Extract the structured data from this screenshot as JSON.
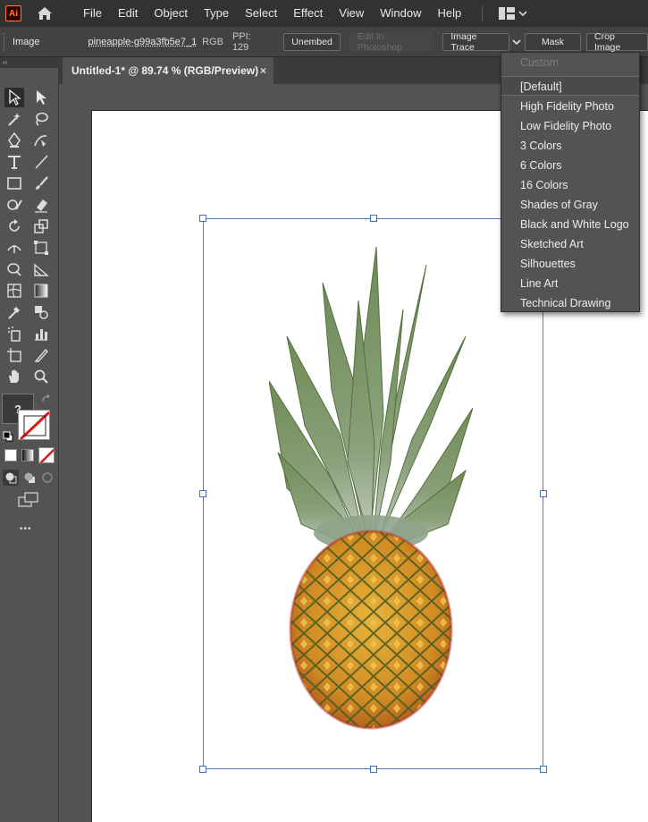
{
  "app": {
    "logo_text": "Ai"
  },
  "menubar": {
    "items": [
      "File",
      "Edit",
      "Object",
      "Type",
      "Select",
      "Effect",
      "View",
      "Window",
      "Help"
    ]
  },
  "control_bar": {
    "object_kind": "Image",
    "filename": "pineapple-g99a3fb5e7_1...",
    "color_mode": "RGB",
    "ppi": "PPI: 129",
    "unembed_label": "Unembed",
    "edit_photoshop_label": "Edit In Photoshop",
    "image_trace_label": "Image Trace",
    "mask_label": "Mask",
    "crop_label": "Crop Image"
  },
  "document": {
    "tab_title": "Untitled-1* @ 89.74 % (RGB/Preview)",
    "close_glyph": "×"
  },
  "toolbar": {
    "collapse_glyph": "‹‹",
    "unknown_fill_label": "?",
    "more_tools_glyph": "•••"
  },
  "trace_presets": {
    "items": [
      {
        "label": "Custom",
        "disabled": true
      },
      {
        "label": "[Default]",
        "active": true
      },
      {
        "label": "High Fidelity Photo"
      },
      {
        "label": "Low Fidelity Photo"
      },
      {
        "label": "3 Colors"
      },
      {
        "label": "6 Colors"
      },
      {
        "label": "16 Colors"
      },
      {
        "label": "Shades of Gray"
      },
      {
        "label": "Black and White Logo"
      },
      {
        "label": "Sketched Art"
      },
      {
        "label": "Silhouettes"
      },
      {
        "label": "Line Art"
      },
      {
        "label": "Technical Drawing"
      }
    ]
  },
  "colors": {
    "accent_orange": "#ff7f18",
    "selection_blue": "#4f80c0",
    "pineapple_body": "#d9a12a",
    "pineapple_leaves": "#6e8a5a"
  }
}
